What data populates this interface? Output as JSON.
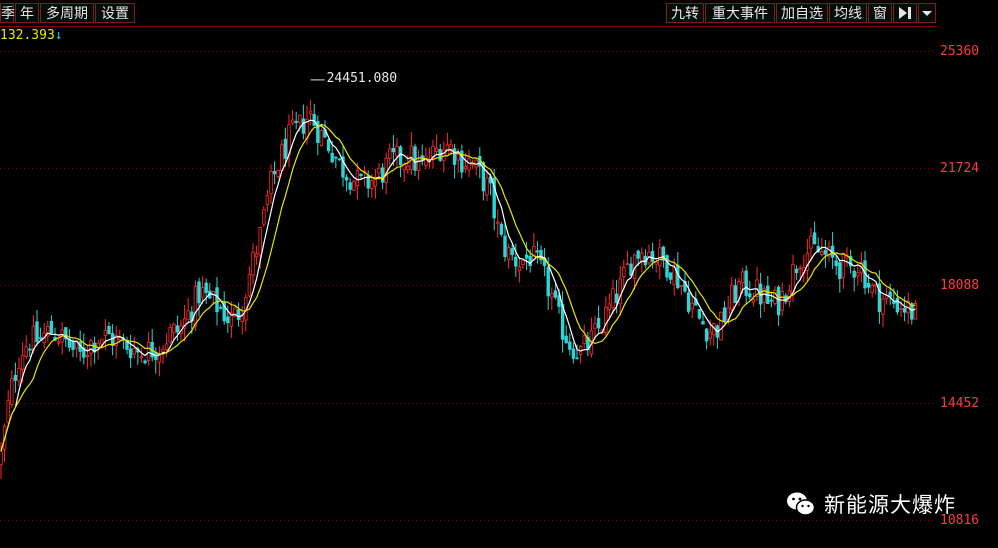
{
  "toolbar": {
    "left": [
      "季",
      "年",
      "多周期",
      "设置"
    ],
    "right": [
      "九转",
      "重大事件",
      "加自选",
      "均线",
      "窗"
    ],
    "icon_play": "play-end-icon",
    "icon_dropdown": "chevron-down-icon"
  },
  "indicator": {
    "value": "132.393",
    "arrow": "↓"
  },
  "watermark": {
    "text": "新能源大爆炸",
    "icon": "wechat-icon"
  },
  "chart_data": {
    "type": "candlestick",
    "y_ticks": [
      25360,
      21724,
      18088,
      14452,
      10816
    ],
    "ylim": [
      9950,
      26120
    ],
    "max_label": "24451.080",
    "colors": {
      "up": "#ff2a2a",
      "down": "#2ad6d6",
      "ma_short": "#ffffff",
      "ma_long": "#e6e600",
      "grid": "#7a0000",
      "axis": "#8b0000"
    },
    "close_path": [
      [
        0,
        12600
      ],
      [
        10,
        14700
      ],
      [
        20,
        16000
      ],
      [
        30,
        16400
      ],
      [
        40,
        16400
      ],
      [
        50,
        16700
      ],
      [
        60,
        16500
      ],
      [
        70,
        16200
      ],
      [
        80,
        15900
      ],
      [
        90,
        16300
      ],
      [
        100,
        16500
      ],
      [
        110,
        16500
      ],
      [
        120,
        16300
      ],
      [
        130,
        16200
      ],
      [
        140,
        16000
      ],
      [
        150,
        16100
      ],
      [
        160,
        16200
      ],
      [
        170,
        16600
      ],
      [
        180,
        16700
      ],
      [
        190,
        17300
      ],
      [
        200,
        17900
      ],
      [
        210,
        17600
      ],
      [
        220,
        17400
      ],
      [
        230,
        17000
      ],
      [
        240,
        17300
      ],
      [
        250,
        18500
      ],
      [
        260,
        19600
      ],
      [
        270,
        21100
      ],
      [
        280,
        22000
      ],
      [
        290,
        22700
      ],
      [
        300,
        23000
      ],
      [
        310,
        23400
      ],
      [
        320,
        22800
      ],
      [
        330,
        22400
      ],
      [
        340,
        21800
      ],
      [
        350,
        21500
      ],
      [
        360,
        21200
      ],
      [
        370,
        21300
      ],
      [
        380,
        21500
      ],
      [
        390,
        21900
      ],
      [
        400,
        22000
      ],
      [
        410,
        22100
      ],
      [
        420,
        21700
      ],
      [
        430,
        22000
      ],
      [
        440,
        22400
      ],
      [
        450,
        22400
      ],
      [
        460,
        22000
      ],
      [
        470,
        21900
      ],
      [
        480,
        21500
      ],
      [
        490,
        21000
      ],
      [
        500,
        19500
      ],
      [
        510,
        19000
      ],
      [
        520,
        18800
      ],
      [
        530,
        19000
      ],
      [
        540,
        18600
      ],
      [
        550,
        17900
      ],
      [
        560,
        16900
      ],
      [
        570,
        16300
      ],
      [
        580,
        16000
      ],
      [
        590,
        16300
      ],
      [
        600,
        16800
      ],
      [
        610,
        17400
      ],
      [
        620,
        18000
      ],
      [
        630,
        18800
      ],
      [
        640,
        19200
      ],
      [
        650,
        19100
      ],
      [
        660,
        18900
      ],
      [
        670,
        18700
      ],
      [
        680,
        18200
      ],
      [
        690,
        17600
      ],
      [
        700,
        17000
      ],
      [
        710,
        16700
      ],
      [
        720,
        16800
      ],
      [
        730,
        17600
      ],
      [
        740,
        18100
      ],
      [
        750,
        18000
      ],
      [
        760,
        17800
      ],
      [
        770,
        17500
      ],
      [
        780,
        17600
      ],
      [
        790,
        18300
      ],
      [
        800,
        19000
      ],
      [
        810,
        19200
      ],
      [
        820,
        19100
      ],
      [
        830,
        18900
      ],
      [
        840,
        18700
      ],
      [
        850,
        18600
      ],
      [
        860,
        18800
      ],
      [
        870,
        18000
      ],
      [
        880,
        17700
      ],
      [
        890,
        17600
      ],
      [
        900,
        17500
      ],
      [
        910,
        17300
      ],
      [
        918,
        17100
      ]
    ]
  }
}
